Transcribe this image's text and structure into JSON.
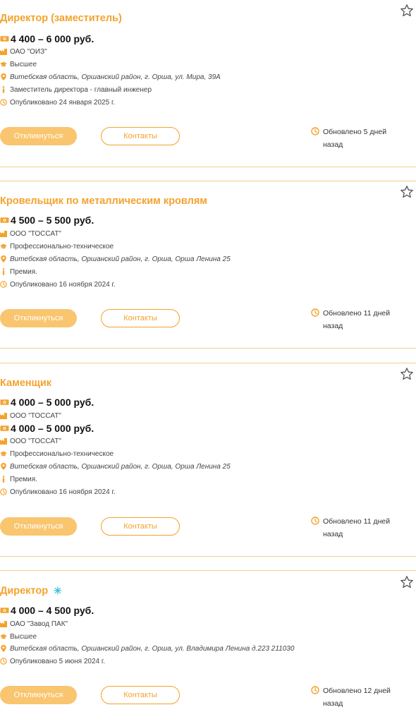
{
  "apply_label": "Откликнуться",
  "contacts_label": "Контакты",
  "updated_prefix": "Обновлено",
  "colors": {
    "accent": "#f4a22d",
    "button_fill": "#f9c56f",
    "divider": "#f4cf8a",
    "sparkle": "#3cc3d6"
  },
  "icons": {
    "salary": "money-icon",
    "company": "factory-icon",
    "education": "graduation-cap-icon",
    "address": "map-pin-icon",
    "info": "info-icon",
    "published": "clock-icon",
    "favorite": "star-icon",
    "updated": "clock-icon",
    "promoted": "sparkle-icon"
  },
  "cards": [
    {
      "title": "Директор (заместитель)",
      "salary": "4 400 – 6 000 руб.",
      "company": "ОАО \"ОИЗ\"",
      "education": "Высшее",
      "address": "Витебская область, Оршанский район, г. Орша, ул. Мира, 39А",
      "info": "Заместитель директора - главный инженер",
      "published": "Опубликовано 24 января 2025 г.",
      "updated_line1": "Обновлено 5 дней",
      "updated_line2": "назад"
    },
    {
      "title": "Кровельщик по металлическим кровлям",
      "salary": "4 500 – 5 500 руб.",
      "company": "ООО \"ТОССАТ\"",
      "education": "Профессионально-техническое",
      "address": "Витебская область, Оршанский район, г. Орша, Орша Ленина 25",
      "info": "Премия.",
      "published": "Опубликовано 16 ноября 2024 г.",
      "updated_line1": "Обновлено 11 дней",
      "updated_line2": "назад"
    },
    {
      "title": "Каменщик",
      "salary": "4 000 – 5 000 руб.",
      "company": "ООО \"ТОССАТ\"",
      "salary_dup": "4 000 – 5 000 руб.",
      "company_dup": "ООО \"ТОССАТ\"",
      "education": "Профессионально-техническое",
      "address": "Витебская область, Оршанский район, г. Орша, Орша Ленина 25",
      "info": "Премия.",
      "published": "Опубликовано 16 ноября 2024 г.",
      "updated_line1": "Обновлено 11 дней",
      "updated_line2": "назад"
    },
    {
      "title": "Директор",
      "salary": "4 000 – 4 500 руб.",
      "company": "ОАО \"Завод ПАК\"",
      "education": "Высшее",
      "address": "Витебская область, Оршанский район, г. Орша, ул. Владимира Ленина д.223 211030",
      "published": "Опубликовано 5 июня 2024 г.",
      "updated_line1": "Обновлено 12 дней",
      "updated_line2": "назад"
    }
  ]
}
